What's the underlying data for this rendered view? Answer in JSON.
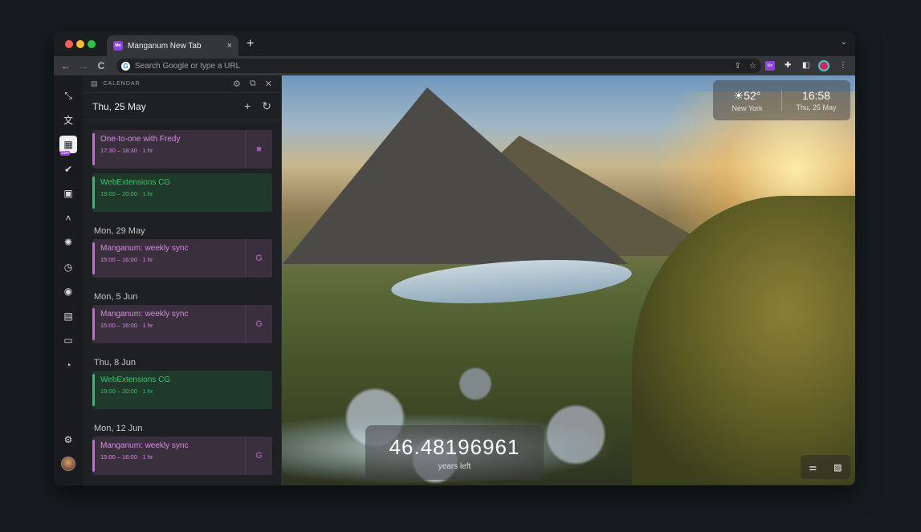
{
  "tab": {
    "title": "Manganum New Tab",
    "favicon": "Mn",
    "close": "×",
    "new": "+"
  },
  "omnibox": {
    "placeholder": "Search Google or type a URL"
  },
  "toolbar": {
    "back": "←",
    "forward": "→",
    "reload": "C"
  },
  "panel": {
    "header": "CALENDAR",
    "current_date": "Thu, 25 May",
    "days": [
      {
        "label": "",
        "events": [
          {
            "title": "One-to-one with Fredy",
            "time": "17:30 – 18:30 · 1 hr",
            "color": "purple",
            "icon": "video-icon"
          },
          {
            "title": "WebExtensions CG",
            "time": "19:00 – 20:00 · 1 hr",
            "color": "green",
            "icon": ""
          }
        ]
      },
      {
        "label": "Mon, 29 May",
        "events": [
          {
            "title": "Manganum: weekly sync",
            "time": "15:00 – 16:00 · 1 hr",
            "color": "purple",
            "icon": "G"
          }
        ]
      },
      {
        "label": "Mon, 5 Jun",
        "events": [
          {
            "title": "Manganum: weekly sync",
            "time": "15:00 – 16:00 · 1 hr",
            "color": "purple",
            "icon": "G"
          }
        ]
      },
      {
        "label": "Thu, 8 Jun",
        "events": [
          {
            "title": "WebExtensions CG",
            "time": "19:00 – 20:00 · 1 hr",
            "color": "green",
            "icon": ""
          }
        ]
      },
      {
        "label": "Mon, 12 Jun",
        "events": [
          {
            "title": "Manganum: weekly sync",
            "time": "15:00 – 16:00 · 1 hr",
            "color": "purple",
            "icon": "G"
          }
        ]
      }
    ]
  },
  "rail": {
    "badge": "31m"
  },
  "weather": {
    "temp": "52°",
    "city": "New York",
    "time": "16:58",
    "date": "Thu, 25 May"
  },
  "countdown": {
    "value": "46.48196961",
    "label": "years left"
  }
}
